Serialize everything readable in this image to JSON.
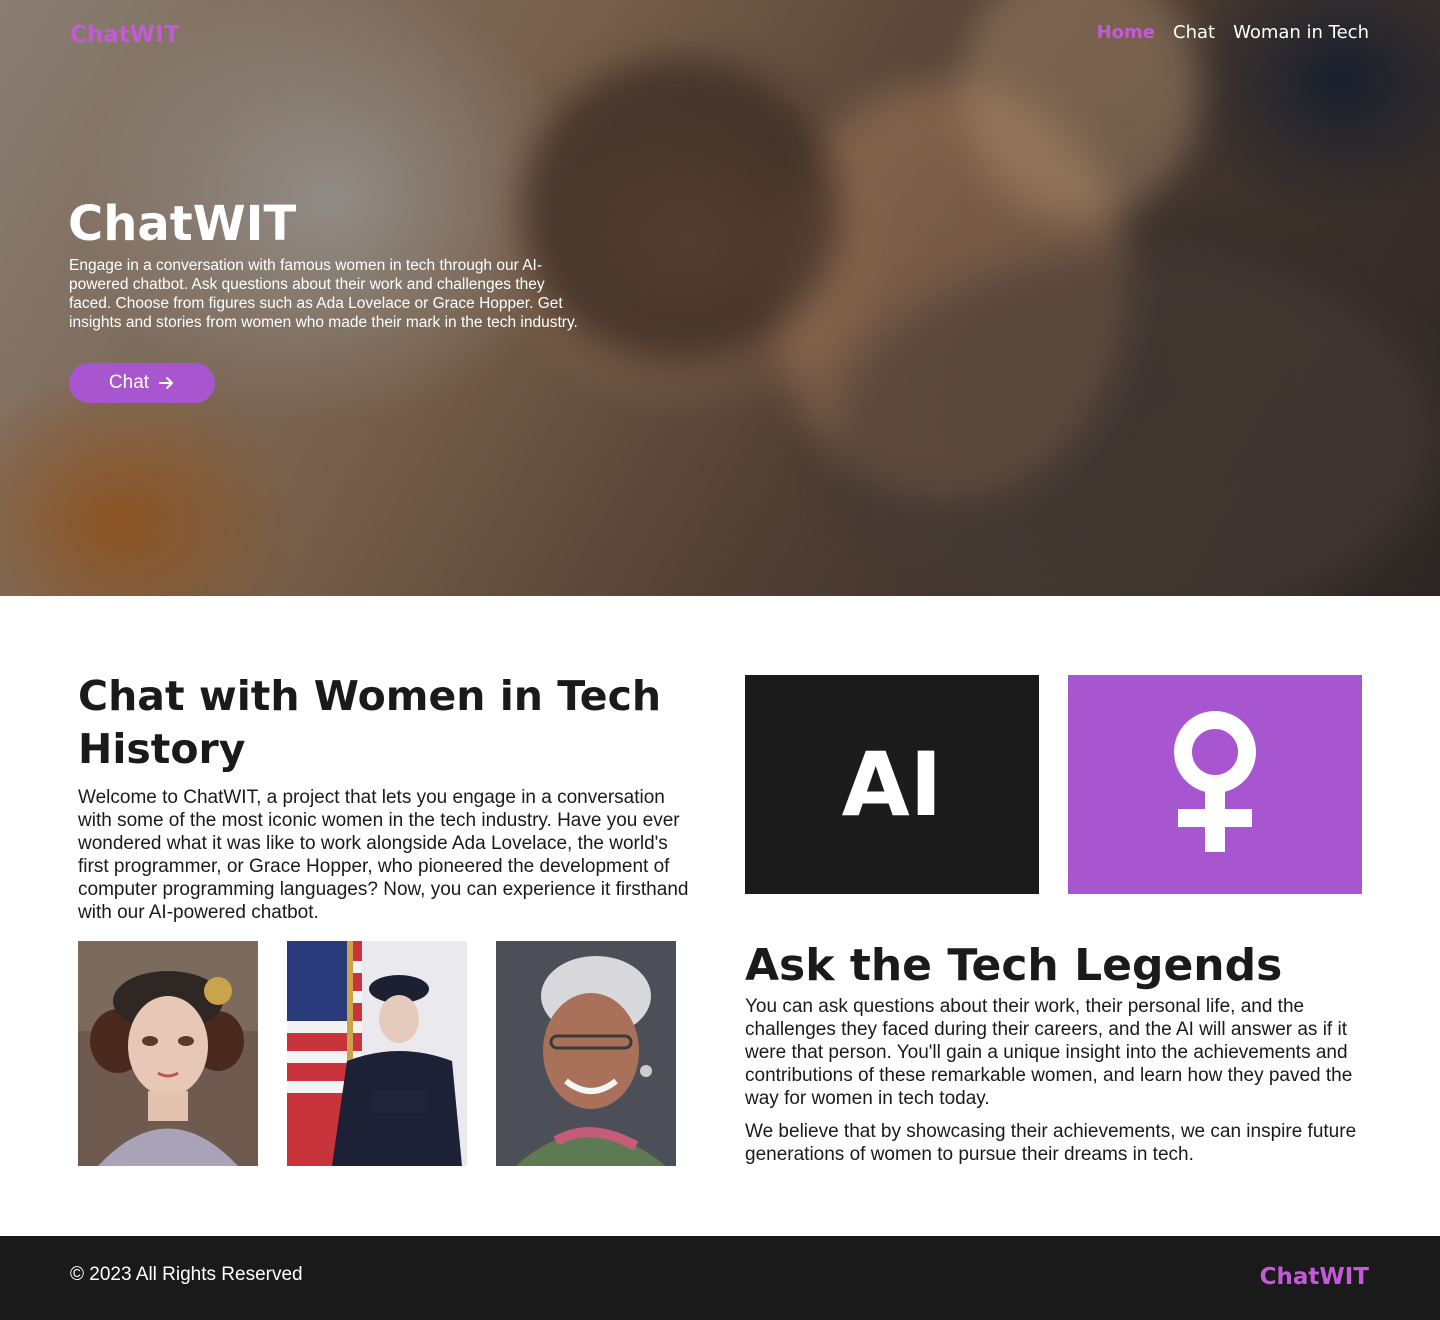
{
  "header": {
    "logo": "ChatWIT",
    "nav": [
      {
        "label": "Home",
        "active": true
      },
      {
        "label": "Chat",
        "active": false
      },
      {
        "label": "Woman in Tech",
        "active": false
      }
    ]
  },
  "hero": {
    "title": "ChatWIT",
    "description": "Engage in a conversation with famous women in tech through our AI-powered chatbot. Ask questions about their work and challenges they faced. Choose from figures such as Ada Lovelace or Grace Hopper. Get insights and stories from women who made their mark in the tech industry.",
    "button_label": "Chat",
    "button_icon": "arrow-right-icon"
  },
  "intro": {
    "title": "Chat with Women in Tech History",
    "text": "Welcome to ChatWIT, a project that lets you engage in a conversation with some of the most iconic women in the tech industry. Have you ever wondered what it was like to work alongside Ada Lovelace, the world's first programmer, or Grace Hopper, who pioneered the development of computer programming languages? Now, you can experience it firsthand with our AI-powered chatbot.",
    "portraits": [
      "ada-lovelace-portrait",
      "grace-hopper-portrait",
      "katherine-johnson-portrait"
    ]
  },
  "tiles": {
    "ai_label": "AI",
    "venus_icon": "female-symbol-icon"
  },
  "legends": {
    "title": "Ask the Tech Legends",
    "paragraph1": "You can ask questions about their work, their personal life, and the challenges they faced during their careers, and the AI will answer as if it were that person. You'll gain a unique insight into the achievements and contributions of these remarkable women, and learn how they paved the way for women in tech today.",
    "paragraph2": "We believe that by showcasing their achievements, we can inspire future generations of women to pursue their dreams in tech."
  },
  "footer": {
    "copyright": "© 2023 All Rights Reserved",
    "logo": "ChatWIT"
  },
  "colors": {
    "accent": "#c45ad8",
    "button": "#a855d0",
    "dark": "#1a1a1a"
  }
}
